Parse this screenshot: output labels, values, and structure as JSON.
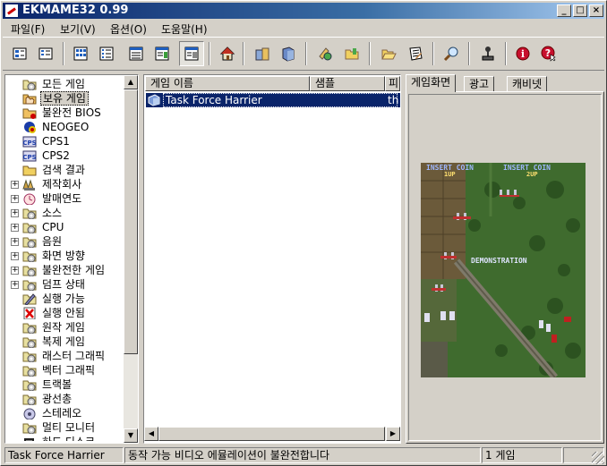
{
  "window": {
    "title": "EKMAME32 0.99"
  },
  "menu": [
    {
      "label": "파일(F)"
    },
    {
      "label": "보기(V)"
    },
    {
      "label": "옵션(O)"
    },
    {
      "label": "도움말(H)"
    }
  ],
  "toolbar": {
    "buttons": [
      {
        "icon": "large-icons-view-icon"
      },
      {
        "icon": "small-icons-view-icon"
      },
      {
        "icon": "list-view-icon"
      },
      {
        "icon": "details-view-icon"
      },
      {
        "icon": "grouped-view-icon"
      },
      {
        "icon": "picture-view-icon"
      },
      {
        "icon": "home-icon"
      },
      {
        "icon": "folders-icon"
      },
      {
        "icon": "cabinet-icon"
      },
      {
        "icon": "properties-icon"
      },
      {
        "icon": "folder-icon"
      },
      {
        "icon": "open-folder-icon"
      },
      {
        "icon": "audit-icon"
      },
      {
        "icon": "search-icon"
      },
      {
        "icon": "joystick-icon"
      },
      {
        "icon": "info-icon"
      },
      {
        "icon": "help-icon"
      }
    ]
  },
  "tree": {
    "items": [
      {
        "label": "모든 게임",
        "icon": "folder-cd-icon",
        "expander": false,
        "selected": false
      },
      {
        "label": "보유 게임",
        "icon": "hand-folder-icon",
        "expander": false,
        "selected": true
      },
      {
        "label": "불완전 BIOS",
        "icon": "bios-icon",
        "expander": false,
        "selected": false
      },
      {
        "label": "NEOGEO",
        "icon": "neogeo-icon",
        "expander": false,
        "selected": false
      },
      {
        "label": "CPS1",
        "icon": "cps-icon",
        "expander": false,
        "selected": false
      },
      {
        "label": "CPS2",
        "icon": "cps-icon",
        "expander": false,
        "selected": false
      },
      {
        "label": "검색 결과",
        "icon": "folder-icon",
        "expander": false,
        "selected": false
      },
      {
        "label": "제작회사",
        "icon": "manufacturer-icon",
        "expander": true,
        "selected": false
      },
      {
        "label": "발매연도",
        "icon": "year-icon",
        "expander": true,
        "selected": false
      },
      {
        "label": "소스",
        "icon": "folder-cd-icon",
        "expander": true,
        "selected": false
      },
      {
        "label": "CPU",
        "icon": "folder-cd-icon",
        "expander": true,
        "selected": false
      },
      {
        "label": "음원",
        "icon": "folder-cd-icon",
        "expander": true,
        "selected": false
      },
      {
        "label": "화면 방향",
        "icon": "folder-cd-icon",
        "expander": true,
        "selected": false
      },
      {
        "label": "불완전한 게임",
        "icon": "folder-cd-icon",
        "expander": true,
        "selected": false
      },
      {
        "label": "덤프 상태",
        "icon": "folder-cd-icon",
        "expander": true,
        "selected": false
      },
      {
        "label": "실행 가능",
        "icon": "working-icon",
        "expander": false,
        "selected": false
      },
      {
        "label": "실행 안됨",
        "icon": "not-working-icon",
        "expander": false,
        "selected": false
      },
      {
        "label": "원작 게임",
        "icon": "folder-cd-icon",
        "expander": false,
        "selected": false
      },
      {
        "label": "복제 게임",
        "icon": "folder-cd-icon",
        "expander": false,
        "selected": false
      },
      {
        "label": "래스터 그래픽",
        "icon": "folder-cd-icon",
        "expander": false,
        "selected": false
      },
      {
        "label": "벡터 그래픽",
        "icon": "folder-cd-icon",
        "expander": false,
        "selected": false
      },
      {
        "label": "트랙볼",
        "icon": "folder-cd-icon",
        "expander": false,
        "selected": false
      },
      {
        "label": "광선총",
        "icon": "folder-cd-icon",
        "expander": false,
        "selected": false
      },
      {
        "label": "스테레오",
        "icon": "stereo-icon",
        "expander": false,
        "selected": false
      },
      {
        "label": "멀티 모니터",
        "icon": "folder-cd-icon",
        "expander": false,
        "selected": false
      },
      {
        "label": "하드 디스크",
        "icon": "harddisk-icon",
        "expander": false,
        "selected": false
      }
    ]
  },
  "game_list": {
    "columns": [
      "게임 이름",
      "샘플",
      "피"
    ],
    "rows": [
      {
        "name": "Task Force Harrier",
        "extra": "th"
      }
    ]
  },
  "tabs": [
    {
      "label": "게임화면",
      "active": true
    },
    {
      "label": "광고",
      "active": false
    },
    {
      "label": "캐비넷",
      "active": false
    }
  ],
  "screenshot": {
    "hud_left": "INSERT COIN",
    "hud_left_sub": "1UP",
    "hud_right": "INSERT COIN",
    "hud_right_sub": "2UP",
    "center_text": "DEMONSTRATION"
  },
  "status": {
    "game": "Task Force Harrier",
    "message": "동작 가능  비디오 에뮬레이션이 불완전합니다",
    "count": "1 게임"
  },
  "colors": {
    "selection": "#0a246a",
    "title_start": "#0a246a",
    "title_end": "#a6caf0",
    "face": "#d4d0c8"
  }
}
